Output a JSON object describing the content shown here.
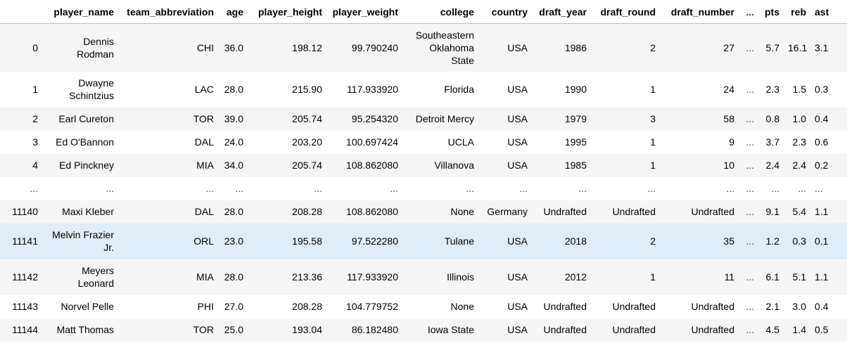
{
  "table": {
    "columns": [
      "",
      "player_name",
      "team_abbreviation",
      "age",
      "player_height",
      "player_weight",
      "college",
      "country",
      "draft_year",
      "draft_round",
      "draft_number",
      "...",
      "pts",
      "reb",
      "ast"
    ],
    "rows": [
      [
        "0",
        "Dennis Rodman",
        "CHI",
        "36.0",
        "198.12",
        "99.790240",
        "Southeastern Oklahoma State",
        "USA",
        "1986",
        "2",
        "27",
        "...",
        "5.7",
        "16.1",
        "3.1"
      ],
      [
        "1",
        "Dwayne Schintzius",
        "LAC",
        "28.0",
        "215.90",
        "117.933920",
        "Florida",
        "USA",
        "1990",
        "1",
        "24",
        "...",
        "2.3",
        "1.5",
        "0.3"
      ],
      [
        "2",
        "Earl Cureton",
        "TOR",
        "39.0",
        "205.74",
        "95.254320",
        "Detroit Mercy",
        "USA",
        "1979",
        "3",
        "58",
        "...",
        "0.8",
        "1.0",
        "0.4"
      ],
      [
        "3",
        "Ed O'Bannon",
        "DAL",
        "24.0",
        "203.20",
        "100.697424",
        "UCLA",
        "USA",
        "1995",
        "1",
        "9",
        "...",
        "3.7",
        "2.3",
        "0.6"
      ],
      [
        "4",
        "Ed Pinckney",
        "MIA",
        "34.0",
        "205.74",
        "108.862080",
        "Villanova",
        "USA",
        "1985",
        "1",
        "10",
        "...",
        "2.4",
        "2.4",
        "0.2"
      ],
      [
        "...",
        "...",
        "...",
        "...",
        "...",
        "...",
        "...",
        "...",
        "...",
        "...",
        "...",
        "...",
        "...",
        "...",
        "..."
      ],
      [
        "11140",
        "Maxi Kleber",
        "DAL",
        "28.0",
        "208.28",
        "108.862080",
        "None",
        "Germany",
        "Undrafted",
        "Undrafted",
        "Undrafted",
        "...",
        "9.1",
        "5.4",
        "1.1"
      ],
      [
        "11141",
        "Melvin Frazier Jr.",
        "ORL",
        "23.0",
        "195.58",
        "97.522280",
        "Tulane",
        "USA",
        "2018",
        "2",
        "35",
        "...",
        "1.2",
        "0.3",
        "0.1"
      ],
      [
        "11142",
        "Meyers Leonard",
        "MIA",
        "28.0",
        "213.36",
        "117.933920",
        "Illinois",
        "USA",
        "2012",
        "1",
        "11",
        "...",
        "6.1",
        "5.1",
        "1.1"
      ],
      [
        "11143",
        "Norvel Pelle",
        "PHI",
        "27.0",
        "208.28",
        "104.779752",
        "None",
        "USA",
        "Undrafted",
        "Undrafted",
        "Undrafted",
        "...",
        "2.1",
        "3.0",
        "0.4"
      ],
      [
        "11144",
        "Matt Thomas",
        "TOR",
        "25.0",
        "193.04",
        "86.182480",
        "Iowa State",
        "USA",
        "Undrafted",
        "Undrafted",
        "Undrafted",
        "...",
        "4.5",
        "1.4",
        "0.5"
      ]
    ]
  }
}
